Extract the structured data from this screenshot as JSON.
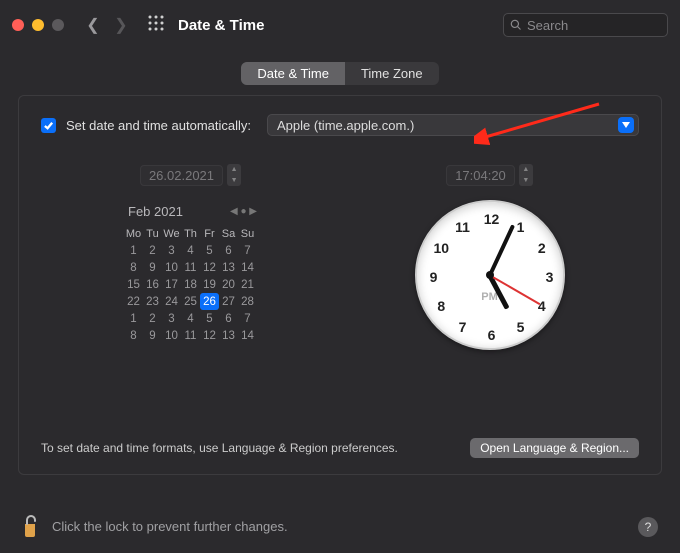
{
  "window": {
    "title": "Date & Time",
    "search_placeholder": "Search"
  },
  "tabs": {
    "date_time": "Date & Time",
    "time_zone": "Time Zone",
    "active": "date_time"
  },
  "auto": {
    "checked": true,
    "label": "Set date and time automatically:",
    "server": "Apple (time.apple.com.)"
  },
  "date_field": "26.02.2021",
  "time_field": "17:04:20",
  "calendar": {
    "month_label": "Feb 2021",
    "weekdays": [
      "Mo",
      "Tu",
      "We",
      "Th",
      "Fr",
      "Sa",
      "Su"
    ],
    "weeks": [
      [
        1,
        2,
        3,
        4,
        5,
        6,
        7
      ],
      [
        8,
        9,
        10,
        11,
        12,
        13,
        14
      ],
      [
        15,
        16,
        17,
        18,
        19,
        20,
        21
      ],
      [
        22,
        23,
        24,
        25,
        26,
        27,
        28
      ],
      [
        1,
        2,
        3,
        4,
        5,
        6,
        7
      ],
      [
        8,
        9,
        10,
        11,
        12,
        13,
        14
      ]
    ],
    "selected_day": 26,
    "selected_week": 3
  },
  "clock": {
    "numbers": [
      "12",
      "1",
      "2",
      "3",
      "4",
      "5",
      "6",
      "7",
      "8",
      "9",
      "10",
      "11"
    ],
    "indicator": "PM",
    "hour_angle": 152,
    "minute_angle": 25,
    "second_angle": 120
  },
  "footer": {
    "hint": "To set date and time formats, use Language & Region preferences.",
    "open_btn": "Open Language & Region..."
  },
  "lock": {
    "text": "Click the lock to prevent further changes.",
    "help": "?"
  }
}
